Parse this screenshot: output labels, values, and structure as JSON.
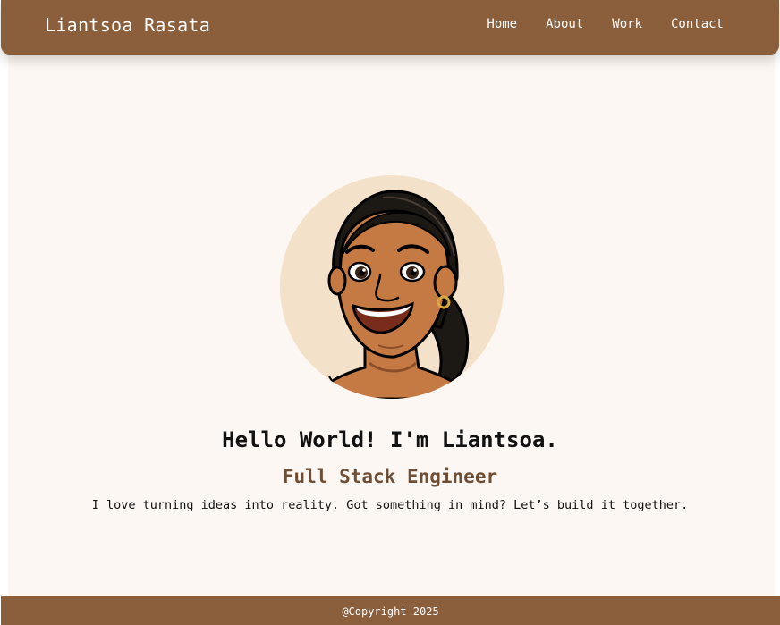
{
  "navbar": {
    "brand": "Liantsoa Rasata",
    "links": [
      "Home",
      "About",
      "Work",
      "Contact"
    ]
  },
  "hero": {
    "avatar_alt": "avatar",
    "greeting": "Hello World! I'm Liantsoa.",
    "role": "Full Stack Engineer",
    "tagline": "I love turning ideas into reality. Got something in mind? Let’s build it together."
  },
  "footer": {
    "copyright": "@Copyright 2025"
  },
  "colors": {
    "brand_brown": "#8b5e3c",
    "page_background": "#fdf7f3",
    "role_text": "#6e4e35",
    "avatar_circle": "#f3e2c9"
  }
}
